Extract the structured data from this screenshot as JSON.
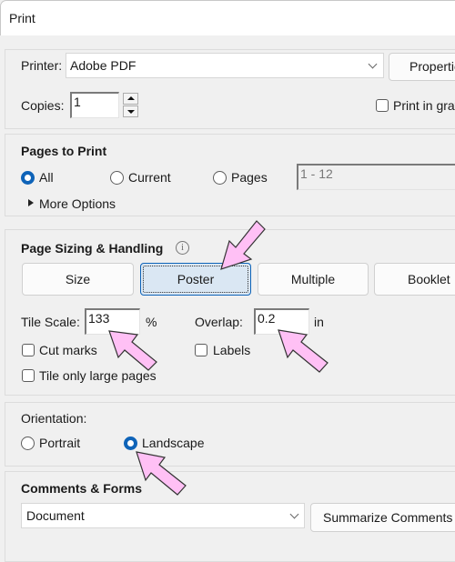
{
  "window": {
    "title": "Print"
  },
  "printer": {
    "label": "Printer:",
    "selected": "Adobe PDF",
    "properties_button": "Properties",
    "copies_label": "Copies:",
    "copies_value": "1",
    "grayscale_label": "Print in grayscale",
    "grayscale_checked": false
  },
  "pages": {
    "heading": "Pages to Print",
    "options": [
      {
        "label": "All",
        "selected": true
      },
      {
        "label": "Current",
        "selected": false
      },
      {
        "label": "Pages",
        "selected": false
      }
    ],
    "range_value": "1 - 12",
    "more_options": "More Options"
  },
  "sizing": {
    "heading": "Page Sizing & Handling",
    "info_icon": "i",
    "buttons": [
      {
        "label": "Size",
        "selected": false
      },
      {
        "label": "Poster",
        "selected": true
      },
      {
        "label": "Multiple",
        "selected": false
      },
      {
        "label": "Booklet",
        "selected": false
      }
    ],
    "tile_scale_label": "Tile Scale:",
    "tile_scale_value": "133",
    "tile_scale_unit": "%",
    "overlap_label": "Overlap:",
    "overlap_value": "0.2",
    "overlap_unit": "in",
    "cut_marks_label": "Cut marks",
    "cut_marks_checked": false,
    "labels_label": "Labels",
    "labels_checked": false,
    "tile_large_label": "Tile only large pages",
    "tile_large_checked": false
  },
  "orientation": {
    "heading": "Orientation:",
    "options": [
      {
        "label": "Portrait",
        "selected": false
      },
      {
        "label": "Landscape",
        "selected": true
      }
    ]
  },
  "comments": {
    "heading": "Comments & Forms",
    "selected": "Document",
    "summarize_button": "Summarize Comments"
  },
  "annotations": {
    "arrow_color": "#ffc0f5"
  }
}
